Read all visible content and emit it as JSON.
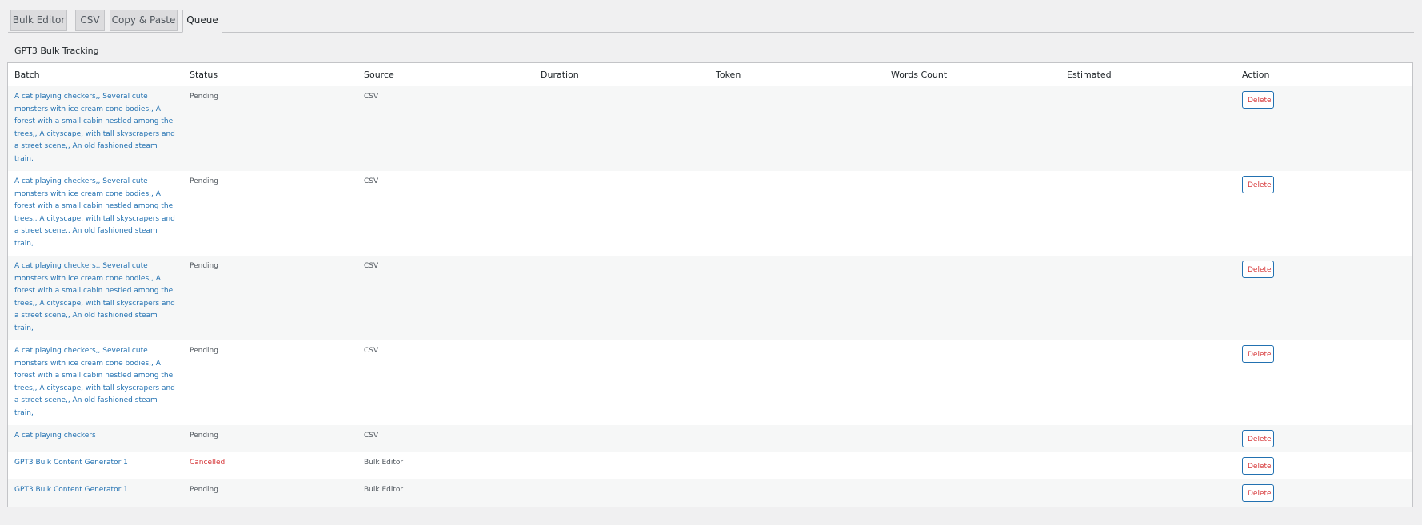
{
  "tabs": [
    {
      "label": "Bulk Editor",
      "active": false
    },
    {
      "label": "CSV",
      "active": false
    },
    {
      "label": "Copy & Paste",
      "active": false
    },
    {
      "label": "Queue",
      "active": true
    }
  ],
  "section_title": "GPT3 Bulk Tracking",
  "columns": [
    "Batch",
    "Status",
    "Source",
    "Duration",
    "Token",
    "Words Count",
    "Estimated",
    "Action"
  ],
  "rows": [
    {
      "batch": "A cat playing checkers,, Several cute monsters with ice cream cone bodies,, A forest with a small cabin nestled among the trees,, A cityscape, with tall skyscrapers and a street scene,, An old fashioned steam train,",
      "status": "Pending",
      "source": "CSV",
      "action": "Delete"
    },
    {
      "batch": "A cat playing checkers,, Several cute monsters with ice cream cone bodies,, A forest with a small cabin nestled among the trees,, A cityscape, with tall skyscrapers and a street scene,, An old fashioned steam train,",
      "status": "Pending",
      "source": "CSV",
      "action": "Delete"
    },
    {
      "batch": "A cat playing checkers,, Several cute monsters with ice cream cone bodies,, A forest with a small cabin nestled among the trees,, A cityscape, with tall skyscrapers and a street scene,, An old fashioned steam train,",
      "status": "Pending",
      "source": "CSV",
      "action": "Delete"
    },
    {
      "batch": "A cat playing checkers,, Several cute monsters with ice cream cone bodies,, A forest with a small cabin nestled among the trees,, A cityscape, with tall skyscrapers and a street scene,, An old fashioned steam train,",
      "status": "Pending",
      "source": "CSV",
      "action": "Delete"
    },
    {
      "batch": "A cat playing checkers",
      "status": "Pending",
      "source": "CSV",
      "action": "Delete"
    },
    {
      "batch": "GPT3 Bulk Content Generator 1",
      "status": "Cancelled",
      "source": "Bulk Editor",
      "action": "Delete"
    },
    {
      "batch": "GPT3 Bulk Content Generator 1",
      "status": "Pending",
      "source": "Bulk Editor",
      "action": "Delete"
    }
  ]
}
